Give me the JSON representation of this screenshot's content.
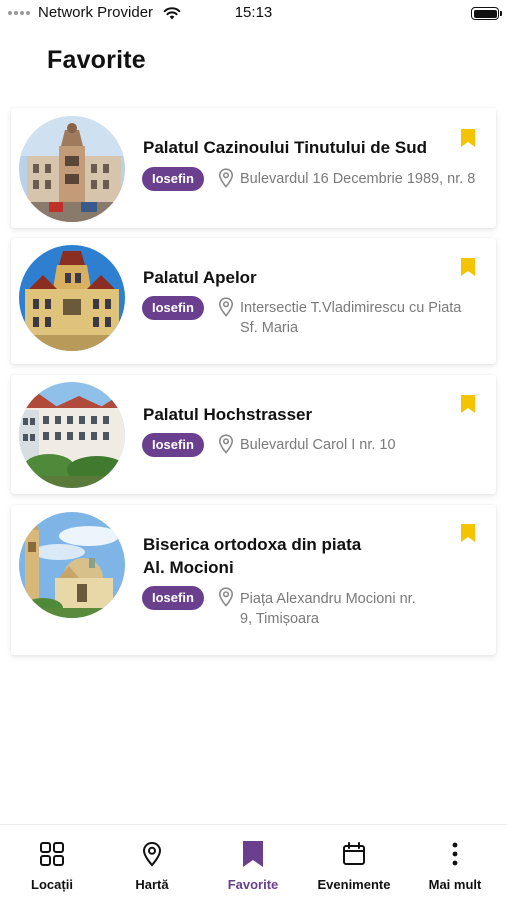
{
  "status_bar": {
    "carrier": "Network Provider",
    "time": "15:13"
  },
  "page": {
    "title": "Favorite"
  },
  "favorites": [
    {
      "title": "Palatul Cazinoului Tinutului de Sud",
      "tag": "Iosefin",
      "address": "Bulevardul 16 Decembrie 1989, nr. 8",
      "bookmark_color": "#f5c400"
    },
    {
      "title": "Palatul Apelor",
      "tag": "Iosefin",
      "address_line1": "Intersectie T.Vladimirescu cu Piata",
      "address_line2": "Sf. Maria",
      "bookmark_color": "#f5c400"
    },
    {
      "title": "Palatul Hochstrasser",
      "tag": "Iosefin",
      "address": "Bulevardul Carol I nr. 10",
      "bookmark_color": "#f5c400"
    },
    {
      "title_line1": "Biserica ortodoxa din piata",
      "title_line2": "Al. Mocioni",
      "tag": "Iosefin",
      "address_line1": "Piața Alexandru Mocioni nr.",
      "address_line2": "9, Timișoara",
      "bookmark_color": "#f5c400"
    }
  ],
  "tab_bar": {
    "tabs": [
      {
        "label": "Locații",
        "icon": "grid-icon"
      },
      {
        "label": "Hartă",
        "icon": "map-pin-icon"
      },
      {
        "label": "Favorite",
        "icon": "bookmark-icon",
        "active": true
      },
      {
        "label": "Evenimente",
        "icon": "calendar-icon"
      },
      {
        "label": "Mai mult",
        "icon": "more-vertical-icon"
      }
    ]
  },
  "colors": {
    "accent": "#6a3f8e",
    "bookmark": "#f5c400",
    "muted_text": "#7a7a7a"
  }
}
